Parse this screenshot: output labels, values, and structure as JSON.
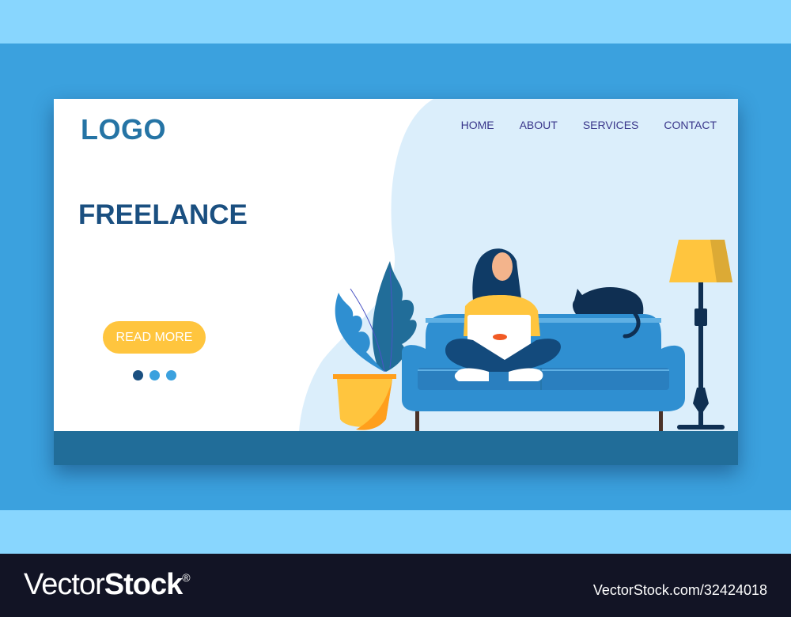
{
  "colors": {
    "background_outer": "#88d6fe",
    "background_frame": "#3ba1de",
    "card": "#ffffff",
    "blob": "#dbeefb",
    "floor": "#216d99",
    "logo": "#2574a5",
    "nav_text": "#38358a",
    "title": "#1a4f80",
    "cta": "#ffc53e",
    "footer": "#121425"
  },
  "header": {
    "logo": "LOGO",
    "nav": [
      {
        "label": "HOME"
      },
      {
        "label": "ABOUT"
      },
      {
        "label": "SERVICES"
      },
      {
        "label": "CONTACT"
      }
    ]
  },
  "hero": {
    "title": "FREELANCE",
    "cta_label": "READ MORE",
    "slider": {
      "total": 3,
      "active_index": 0
    }
  },
  "illustration": {
    "elements": [
      "plant-in-pot",
      "sofa",
      "woman-with-laptop",
      "sleeping-cat",
      "floor-lamp"
    ]
  },
  "watermark": {
    "brand_light": "Vector",
    "brand_bold": "Stock",
    "registered": "®",
    "reference": "VectorStock.com/32424018"
  }
}
